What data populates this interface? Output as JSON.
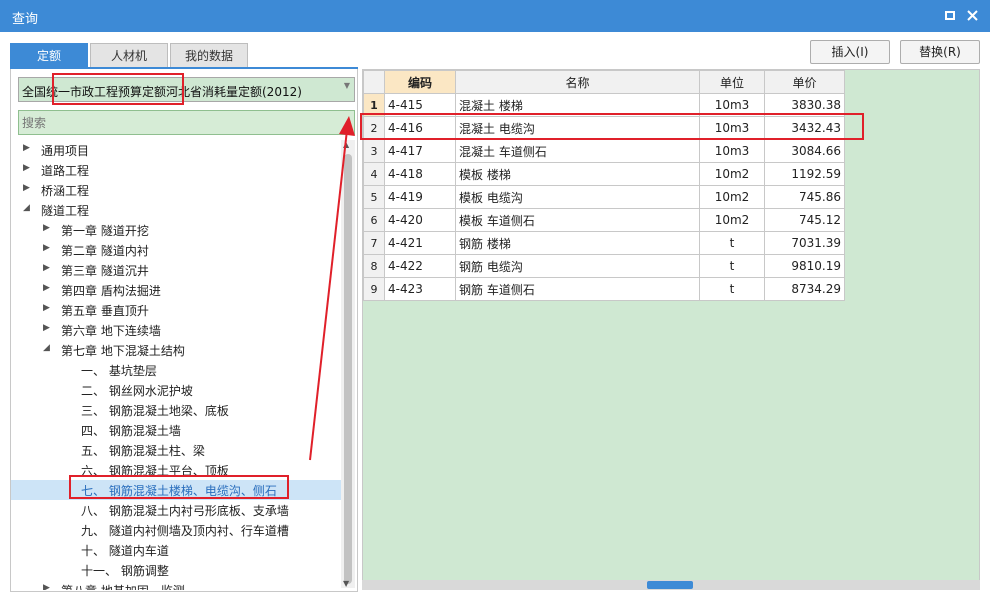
{
  "window": {
    "title": "查询",
    "restore_icon": "restore-icon",
    "close_icon": "close-icon"
  },
  "tabs": [
    {
      "label": "定额",
      "active": true
    },
    {
      "label": "人材机"
    },
    {
      "label": "我的数据"
    }
  ],
  "toolbar": {
    "insert_label": "插入(I)",
    "replace_label": "替换(R)"
  },
  "library_combo": {
    "value": "全国统一市政工程预算定额河北省消耗量定额(2012)"
  },
  "search": {
    "placeholder": "搜索"
  },
  "tree": [
    {
      "label": "通用项目",
      "level": 0,
      "state": "collapsed"
    },
    {
      "label": "道路工程",
      "level": 0,
      "state": "collapsed"
    },
    {
      "label": "桥涵工程",
      "level": 0,
      "state": "collapsed"
    },
    {
      "label": "隧道工程",
      "level": 0,
      "state": "expanded"
    },
    {
      "label": "第一章 隧道开挖",
      "level": 1,
      "state": "collapsed"
    },
    {
      "label": "第二章 隧道内衬",
      "level": 1,
      "state": "collapsed"
    },
    {
      "label": "第三章 隧道沉井",
      "level": 1,
      "state": "collapsed"
    },
    {
      "label": "第四章 盾构法掘进",
      "level": 1,
      "state": "collapsed"
    },
    {
      "label": "第五章 垂直顶升",
      "level": 1,
      "state": "collapsed"
    },
    {
      "label": "第六章 地下连续墙",
      "level": 1,
      "state": "collapsed"
    },
    {
      "label": "第七章 地下混凝土结构",
      "level": 1,
      "state": "expanded"
    },
    {
      "label": "一、 基坑垫层",
      "level": 2,
      "state": "leaf"
    },
    {
      "label": "二、 钢丝网水泥护坡",
      "level": 2,
      "state": "leaf"
    },
    {
      "label": "三、 钢筋混凝土地梁、底板",
      "level": 2,
      "state": "leaf"
    },
    {
      "label": "四、 钢筋混凝土墙",
      "level": 2,
      "state": "leaf"
    },
    {
      "label": "五、 钢筋混凝土柱、梁",
      "level": 2,
      "state": "leaf"
    },
    {
      "label": "六、 钢筋混凝土平台、顶板",
      "level": 2,
      "state": "leaf"
    },
    {
      "label": "七、 钢筋混凝土楼梯、电缆沟、侧石",
      "level": 2,
      "state": "leaf",
      "selected": true
    },
    {
      "label": "八、 钢筋混凝土内衬弓形底板、支承墙",
      "level": 2,
      "state": "leaf"
    },
    {
      "label": "九、 隧道内衬侧墙及顶内衬、行车道槽",
      "level": 2,
      "state": "leaf"
    },
    {
      "label": "十、 隧道内车道",
      "level": 2,
      "state": "leaf"
    },
    {
      "label": "十一、 钢筋调整",
      "level": 2,
      "state": "leaf"
    },
    {
      "label": "第八章 地基加固、监测",
      "level": 1,
      "state": "collapsed"
    }
  ],
  "grid": {
    "columns": [
      "编码",
      "名称",
      "单位",
      "单价"
    ],
    "rows": [
      {
        "no": "1",
        "code": "4-415",
        "name": "混凝土 楼梯",
        "unit": "10m3",
        "price": "3830.38",
        "current": true
      },
      {
        "no": "2",
        "code": "4-416",
        "name": "混凝土 电缆沟",
        "unit": "10m3",
        "price": "3432.43"
      },
      {
        "no": "3",
        "code": "4-417",
        "name": "混凝土 车道侧石",
        "unit": "10m3",
        "price": "3084.66"
      },
      {
        "no": "4",
        "code": "4-418",
        "name": "模板 楼梯",
        "unit": "10m2",
        "price": "1192.59"
      },
      {
        "no": "5",
        "code": "4-419",
        "name": "模板 电缆沟",
        "unit": "10m2",
        "price": "745.86"
      },
      {
        "no": "6",
        "code": "4-420",
        "name": "模板 车道侧石",
        "unit": "10m2",
        "price": "745.12"
      },
      {
        "no": "7",
        "code": "4-421",
        "name": "钢筋 楼梯",
        "unit": "t",
        "price": "7031.39"
      },
      {
        "no": "8",
        "code": "4-422",
        "name": "钢筋 电缆沟",
        "unit": "t",
        "price": "9810.19"
      },
      {
        "no": "9",
        "code": "4-423",
        "name": "钢筋 车道侧石",
        "unit": "t",
        "price": "8734.29"
      }
    ]
  },
  "colors": {
    "accent": "#3d8ad6",
    "highlight": "#e0202a",
    "selection": "#cde4f7",
    "grid_background": "#cfe8d2"
  }
}
